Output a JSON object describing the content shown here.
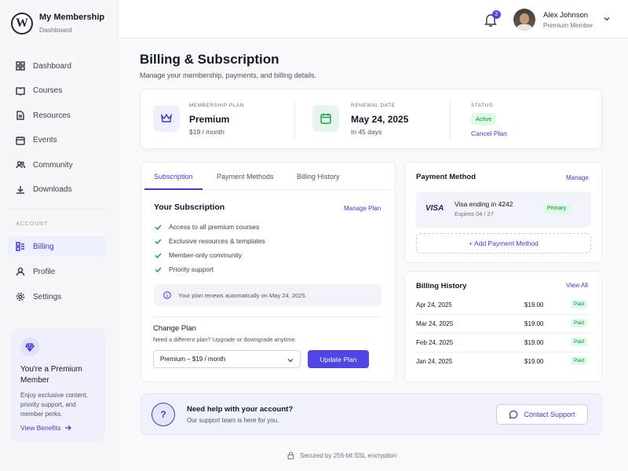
{
  "brand": {
    "title": "My Membership",
    "subtitle": "Dashboard",
    "logo": "wordpress-logo"
  },
  "sidebar": {
    "items": [
      {
        "label": "Dashboard",
        "icon": "grid-icon"
      },
      {
        "label": "Courses",
        "icon": "book-icon"
      },
      {
        "label": "Resources",
        "icon": "document-icon"
      },
      {
        "label": "Events",
        "icon": "calendar-icon"
      },
      {
        "label": "Community",
        "icon": "users-icon"
      },
      {
        "label": "Downloads",
        "icon": "download-icon"
      }
    ],
    "section_label": "ACCOUNT",
    "account_items": [
      {
        "label": "Billing",
        "icon": "billing-icon",
        "active": true
      },
      {
        "label": "Profile",
        "icon": "user-icon"
      },
      {
        "label": "Settings",
        "icon": "gear-icon"
      }
    ],
    "promo": {
      "title": "You're a Premium Member",
      "text": "Enjoy exclusive content, priority support, and member perks.",
      "link": "View Benefits"
    }
  },
  "topbar": {
    "notification_count": "2",
    "user_name": "Alex Johnson",
    "user_role": "Premium Member"
  },
  "page": {
    "title": "Billing & Subscription",
    "subtitle": "Manage your membership, payments, and billing details."
  },
  "summary": {
    "plan_label": "MEMBERSHIP PLAN",
    "plan_value": "Premium",
    "plan_sub": "$19 / month",
    "renewal_label": "RENEWAL DATE",
    "renewal_value": "May 24, 2025",
    "renewal_sub": "In 45 days",
    "status_label": "STATUS",
    "status_value": "Active",
    "cancel_link": "Cancel Plan"
  },
  "subscription": {
    "tabs": [
      "Subscription",
      "Payment Methods",
      "Billing History"
    ],
    "title": "Your Subscription",
    "manage_link": "Manage Plan",
    "features": [
      "Access to all premium courses",
      "Exclusive resources & templates",
      "Member-only community",
      "Priority support"
    ],
    "notice": "Your plan renews automatically on May 24, 2025.",
    "change_title": "Change Plan",
    "change_sub": "Need a different plan? Upgrade or downgrade anytime.",
    "select_value": "Premium – $19 / month",
    "update_button": "Update Plan"
  },
  "payment_method": {
    "title": "Payment Method",
    "manage_link": "Manage",
    "card_brand": "VISA",
    "card_line": "Visa ending in 4242",
    "expires": "Expires 04 / 27",
    "badge": "Primary",
    "add_button": "+ Add Payment Method"
  },
  "billing_history": {
    "title": "Billing History",
    "view_all": "View All",
    "rows": [
      {
        "date": "Apr 24, 2025",
        "amount": "$19.00",
        "status": "Paid"
      },
      {
        "date": "Mar 24, 2025",
        "amount": "$19.00",
        "status": "Paid"
      },
      {
        "date": "Feb 24, 2025",
        "amount": "$19.00",
        "status": "Paid"
      },
      {
        "date": "Jan 24, 2025",
        "amount": "$19.00",
        "status": "Paid"
      }
    ]
  },
  "help": {
    "title": "Need help with your account?",
    "subtitle": "Our support team is here for you.",
    "button": "Contact Support"
  },
  "footer": {
    "secured": "Secured by 256-bit SSL encryption"
  },
  "colors": {
    "accent": "#4f46e5",
    "success": "#15803d",
    "success_bg": "#dcfce7"
  }
}
